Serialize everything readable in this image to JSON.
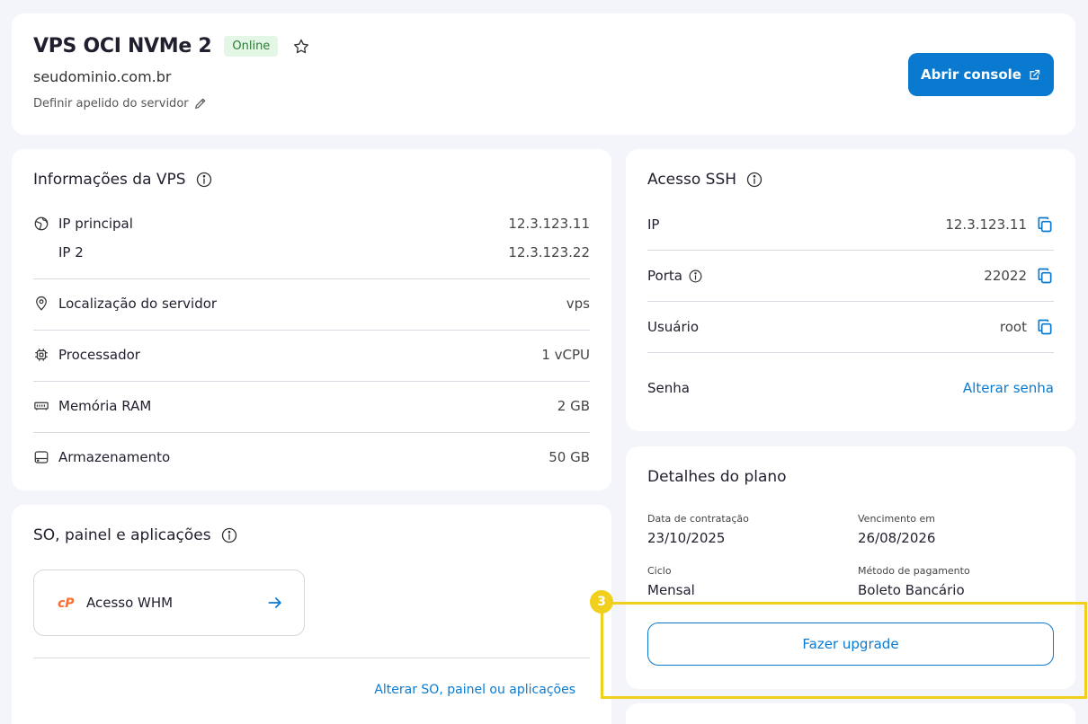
{
  "header": {
    "title": "VPS OCI NVMe 2",
    "status": "Online",
    "domain": "seudominio.com.br",
    "nickname_label": "Definir apelido do servidor",
    "console_button": "Abrir console"
  },
  "vps_info": {
    "title": "Informações da VPS",
    "ip_principal_label": "IP principal",
    "ip_principal_value": "12.3.123.11",
    "ip2_label": "IP 2",
    "ip2_value": "12.3.123.22",
    "location_label": "Localização do servidor",
    "location_value": "vps",
    "cpu_label": "Processador",
    "cpu_value": "1 vCPU",
    "ram_label": "Memória RAM",
    "ram_value": "2 GB",
    "storage_label": "Armazenamento",
    "storage_value": "50 GB"
  },
  "os_panel": {
    "title": "SO, painel e aplicações",
    "whm_label": "Acesso WHM",
    "change_link": "Alterar SO, painel ou aplicações"
  },
  "ssh": {
    "title": "Acesso SSH",
    "ip_label": "IP",
    "ip_value": "12.3.123.11",
    "port_label": "Porta",
    "port_value": "22022",
    "user_label": "Usuário",
    "user_value": "root",
    "password_label": "Senha",
    "password_link": "Alterar senha"
  },
  "plan": {
    "title": "Detalhes do plano",
    "contract_date_label": "Data de contratação",
    "contract_date_value": "23/10/2025",
    "due_date_label": "Vencimento em",
    "due_date_value": "26/08/2026",
    "cycle_label": "Ciclo",
    "cycle_value": "Mensal",
    "payment_label": "Método de pagamento",
    "payment_value": "Boleto Bancário",
    "upgrade_button": "Fazer upgrade"
  },
  "annotation": {
    "step_number": "3",
    "highlight_color": "#f1cf1d"
  },
  "colors": {
    "accent": "#0a7ad1",
    "online_bg": "#e4f6e6",
    "online_text": "#2c7a35",
    "cpanel_orange": "#ff6c2c"
  }
}
